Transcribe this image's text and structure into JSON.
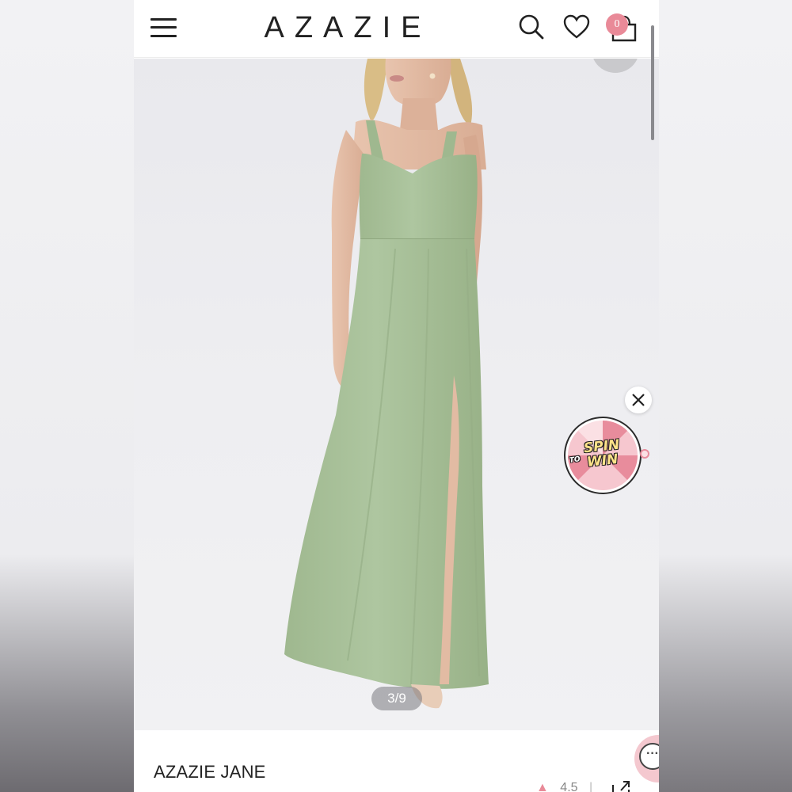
{
  "header": {
    "logo": "AZAZIE",
    "cart_count": "0",
    "icons": [
      "menu-icon",
      "search-icon",
      "heart-icon",
      "shopping-bag-icon"
    ]
  },
  "gallery": {
    "counter": "3/9",
    "dress_color": "#a9c29a"
  },
  "promo": {
    "spin_word": "SPIN",
    "to_word": "TO",
    "win_word": "WIN"
  },
  "product": {
    "name": "AZAZIE JANE",
    "rating": "4.5"
  },
  "colors": {
    "accent": "#e98a98",
    "text": "#222222"
  }
}
